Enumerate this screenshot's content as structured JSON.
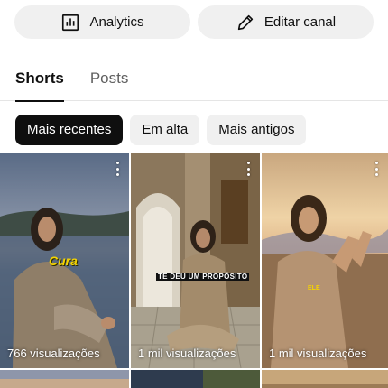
{
  "actions": {
    "analytics_label": "Analytics",
    "edit_label": "Editar canal"
  },
  "tabs": [
    {
      "label": "Shorts"
    },
    {
      "label": "Posts"
    }
  ],
  "filters": [
    {
      "label": "Mais recentes"
    },
    {
      "label": "Em alta"
    },
    {
      "label": "Mais antigos"
    }
  ],
  "shorts": [
    {
      "overlay": "Cura",
      "views": "766 visualizações"
    },
    {
      "overlay": "TE DEU UM PROPÓSITO",
      "views": "1 mil visualizações"
    },
    {
      "overlay": "ELE",
      "views": "1 mil visualizações"
    }
  ],
  "colors": {
    "accent": "#0f0f0f",
    "chip_bg": "#f0f0f0",
    "overlay_yellow": "#f5d400"
  }
}
